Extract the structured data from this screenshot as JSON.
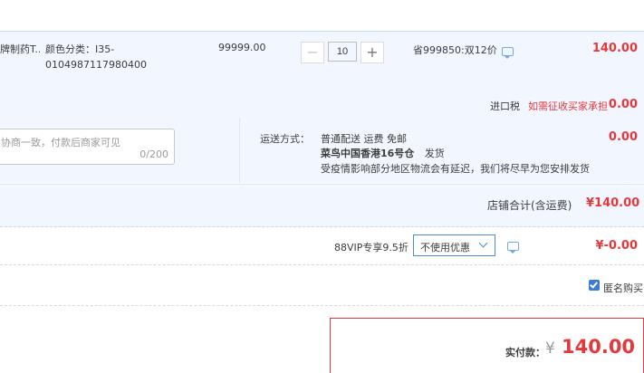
{
  "item": {
    "name": "牌制药T...",
    "sku_text": "颜色分类：I35-0104987117980400",
    "price": "99999.00",
    "quantity": "10",
    "minus_symbol": "−",
    "plus_symbol": "+",
    "promo_text": "省999850:双12价",
    "subtotal": "140.00"
  },
  "tax": {
    "label": "进口税",
    "link_text": "如需征收买家承担",
    "amount": "0.00"
  },
  "message": {
    "placeholder": "协商一致，付款后商家可见",
    "counter": "0/200"
  },
  "shipping": {
    "label": "运送方式：",
    "method_line": "普通配送 运费 免邮",
    "warehouse": "菜鸟中国香港16号仓",
    "dispatch": "发货",
    "notice": "受疫情影响部分地区物流会有延迟，我们将尽早为您安排发货",
    "amount": "0.00"
  },
  "store_total": {
    "label": "店铺合计(含运费)",
    "amount": "¥140.00"
  },
  "vip": {
    "label": "88VIP专享9.5折",
    "select_value": "不使用优惠",
    "discount": "¥-0.00"
  },
  "anonymous": {
    "label": "匿名购买",
    "checked": true
  },
  "payment": {
    "label": "实付款：",
    "currency": "¥",
    "amount": "140.00"
  },
  "colors": {
    "accent_red": "#e4393c",
    "section_bg": "#f2f7ff",
    "link_blue": "#4b8bd8"
  }
}
